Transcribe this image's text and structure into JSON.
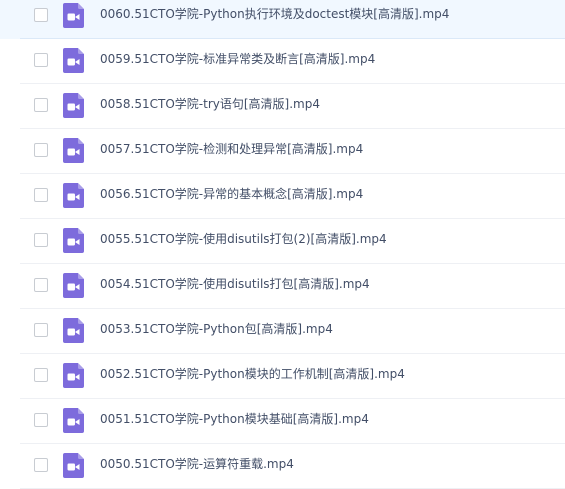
{
  "colors": {
    "icon_purple": "#7d6bdc",
    "text": "#424e67",
    "selected_row": "#f1f8ff"
  },
  "files": [
    {
      "name": "0060.51CTO学院-Python执行环境及doctest模块[高清版].mp4",
      "icon": "video-file-icon",
      "selected": true
    },
    {
      "name": "0059.51CTO学院-标准异常类及断言[高清版].mp4",
      "icon": "video-file-icon",
      "selected": false
    },
    {
      "name": "0058.51CTO学院-try语句[高清版].mp4",
      "icon": "video-file-icon",
      "selected": false
    },
    {
      "name": "0057.51CTO学院-检测和处理异常[高清版].mp4",
      "icon": "video-file-icon",
      "selected": false
    },
    {
      "name": "0056.51CTO学院-异常的基本概念[高清版].mp4",
      "icon": "video-file-icon",
      "selected": false
    },
    {
      "name": "0055.51CTO学院-使用disutils打包(2)[高清版].mp4",
      "icon": "video-file-icon",
      "selected": false
    },
    {
      "name": "0054.51CTO学院-使用disutils打包[高清版].mp4",
      "icon": "video-file-icon",
      "selected": false
    },
    {
      "name": "0053.51CTO学院-Python包[高清版].mp4",
      "icon": "video-file-icon",
      "selected": false
    },
    {
      "name": "0052.51CTO学院-Python模块的工作机制[高清版].mp4",
      "icon": "video-file-icon",
      "selected": false
    },
    {
      "name": "0051.51CTO学院-Python模块基础[高清版].mp4",
      "icon": "video-file-icon",
      "selected": false
    },
    {
      "name": "0050.51CTO学院-运算符重载.mp4",
      "icon": "video-file-icon",
      "selected": false
    }
  ]
}
